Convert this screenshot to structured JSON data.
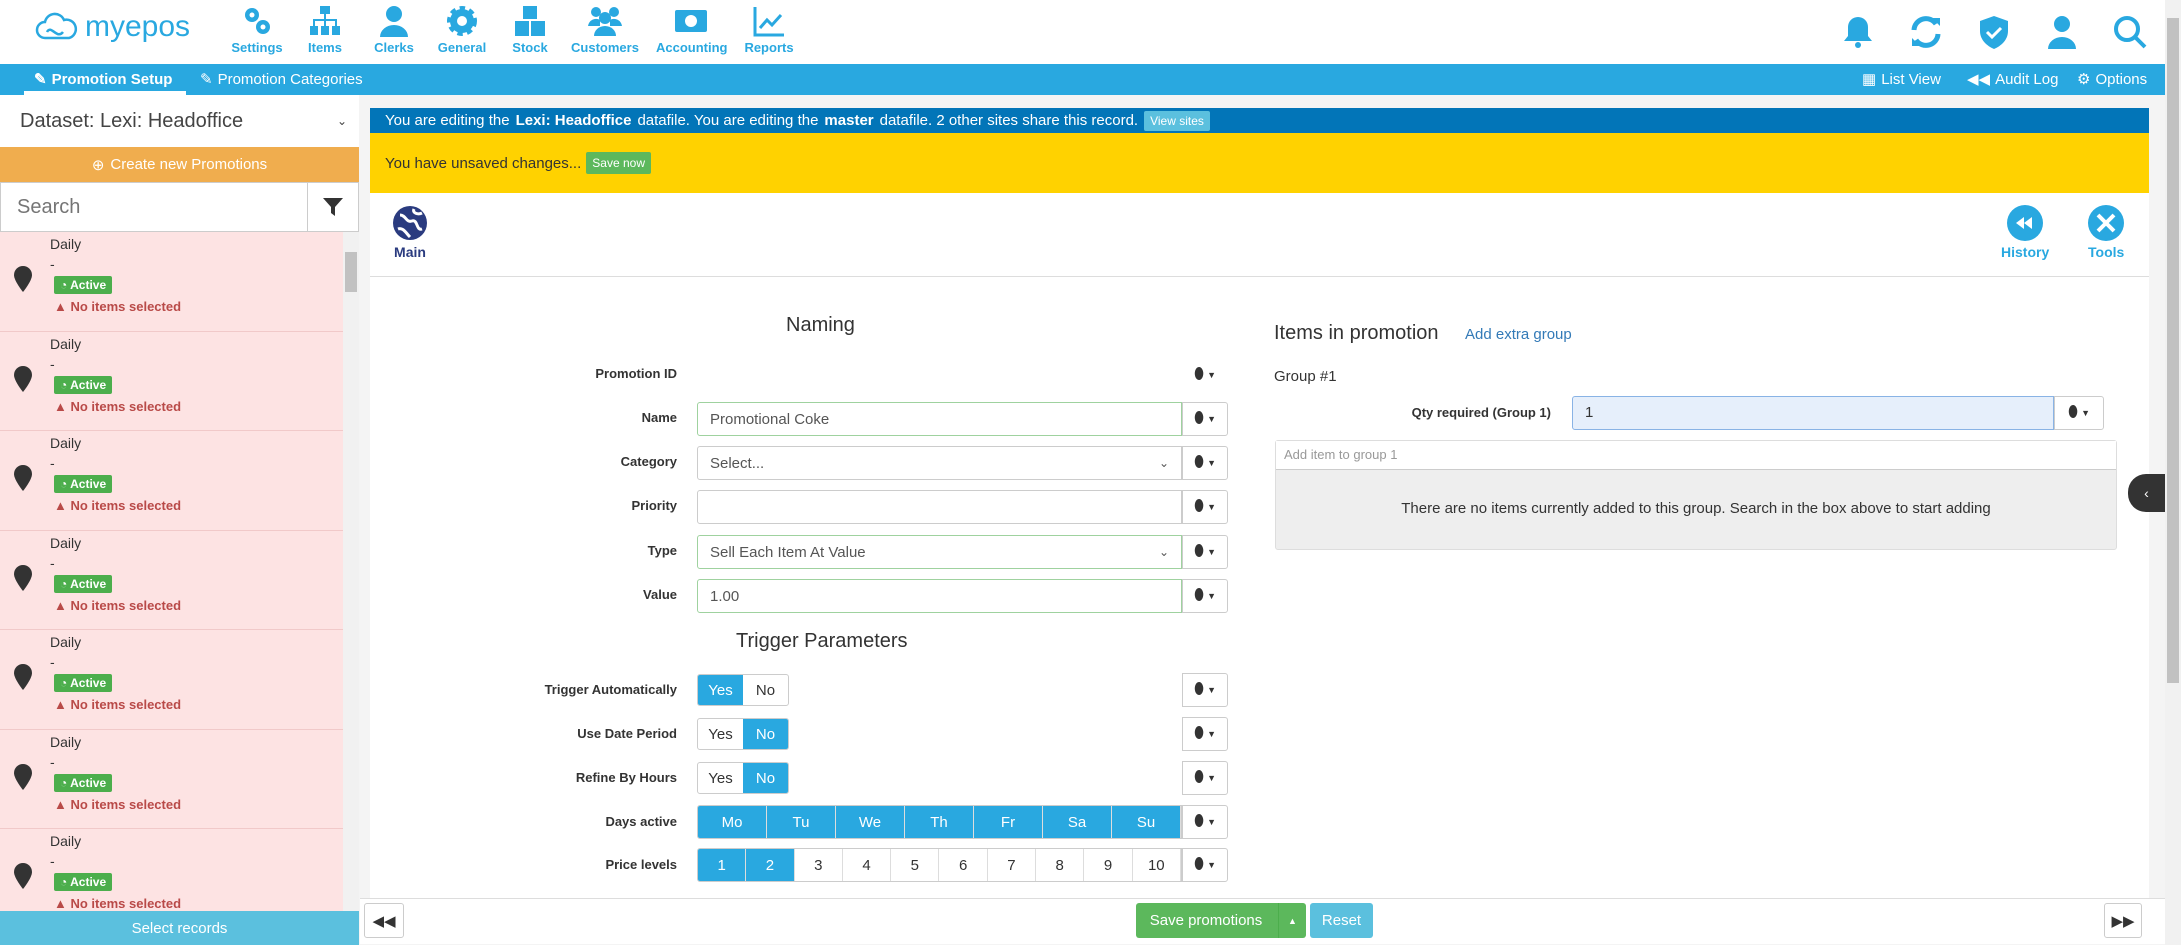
{
  "header": {
    "logo": "myepos",
    "nav": [
      {
        "label": "Settings",
        "icon": "gears-icon"
      },
      {
        "label": "Items",
        "icon": "sitemap-icon"
      },
      {
        "label": "Clerks",
        "icon": "user-icon"
      },
      {
        "label": "General",
        "icon": "gear-icon"
      },
      {
        "label": "Stock",
        "icon": "boxes-icon"
      },
      {
        "label": "Customers",
        "icon": "users-icon"
      },
      {
        "label": "Accounting",
        "icon": "money-icon"
      },
      {
        "label": "Reports",
        "icon": "chart-line-icon"
      }
    ],
    "right_icons": [
      "bell-icon",
      "sync-icon",
      "shield-check-icon",
      "user-icon",
      "search-icon"
    ]
  },
  "subnav": {
    "tabs": [
      "Promotion Setup",
      "Promotion Categories"
    ],
    "actions": [
      "List View",
      "Audit Log",
      "Options"
    ]
  },
  "sidebar": {
    "dataset": "Dataset: Lexi: Headoffice",
    "create": "Create new Promotions",
    "search_placeholder": "Search",
    "select_records": "Select records",
    "items": [
      {
        "title": "Daily",
        "desc": "-",
        "status": "Active",
        "warning": "No items selected"
      },
      {
        "title": "Daily",
        "desc": "-",
        "status": "Active",
        "warning": "No items selected"
      },
      {
        "title": "Daily",
        "desc": "-",
        "status": "Active",
        "warning": "No items selected"
      },
      {
        "title": "Daily",
        "desc": "-",
        "status": "Active",
        "warning": "No items selected"
      },
      {
        "title": "Daily",
        "desc": "-",
        "status": "Active",
        "warning": "No items selected"
      },
      {
        "title": "Daily",
        "desc": "-",
        "status": "Active",
        "warning": "No items selected"
      },
      {
        "title": "Daily",
        "desc": "-",
        "status": "Active",
        "warning": "No items selected"
      }
    ]
  },
  "info": {
    "p1": "You are editing the",
    "b1": "Lexi: Headoffice",
    "p2": "datafile. You are editing the",
    "b2": "master",
    "p3": "datafile. 2 other sites share this record.",
    "button": "View sites"
  },
  "warn": {
    "text": "You have unsaved changes...",
    "button": "Save now"
  },
  "tabs": {
    "main": "Main",
    "history": "History",
    "tools": "Tools"
  },
  "naming": {
    "heading": "Naming",
    "promotion_id_label": "Promotion ID",
    "name_label": "Name",
    "name_value": "Promotional Coke",
    "category_label": "Category",
    "category_value": "Select...",
    "priority_label": "Priority",
    "priority_value": "",
    "type_label": "Type",
    "type_value": "Sell Each Item At Value",
    "value_label": "Value",
    "value_value": "1.00"
  },
  "trigger": {
    "heading": "Trigger Parameters",
    "auto_label": "Trigger Automatically",
    "auto": "Yes",
    "date_label": "Use Date Period",
    "date": "No",
    "hours_label": "Refine By Hours",
    "hours": "No",
    "yes": "Yes",
    "no": "No",
    "days_label": "Days active",
    "days": [
      "Mo",
      "Tu",
      "We",
      "Th",
      "Fr",
      "Sa",
      "Su"
    ],
    "days_selected": [
      "Mo",
      "Tu",
      "We",
      "Th",
      "Fr",
      "Sa",
      "Su"
    ],
    "price_label": "Price levels",
    "price_levels": [
      "1",
      "2",
      "3",
      "4",
      "5",
      "6",
      "7",
      "8",
      "9",
      "10"
    ],
    "price_selected": [
      "1",
      "2"
    ]
  },
  "items": {
    "heading": "Items in promotion",
    "add_group": "Add extra group",
    "group": "Group #1",
    "qty_label": "Qty required (Group 1)",
    "qty_value": "1",
    "add_placeholder": "Add item to group 1",
    "empty": "There are no items currently added to this group. Search in the box above to start adding"
  },
  "footer": {
    "save": "Save promotions",
    "reset": "Reset"
  },
  "colors": {
    "brand": "#29a8e0",
    "orange": "#f0ad4e",
    "success": "#5cb85c",
    "warning_bar": "#ffd200",
    "info_bar": "#0275b8"
  }
}
